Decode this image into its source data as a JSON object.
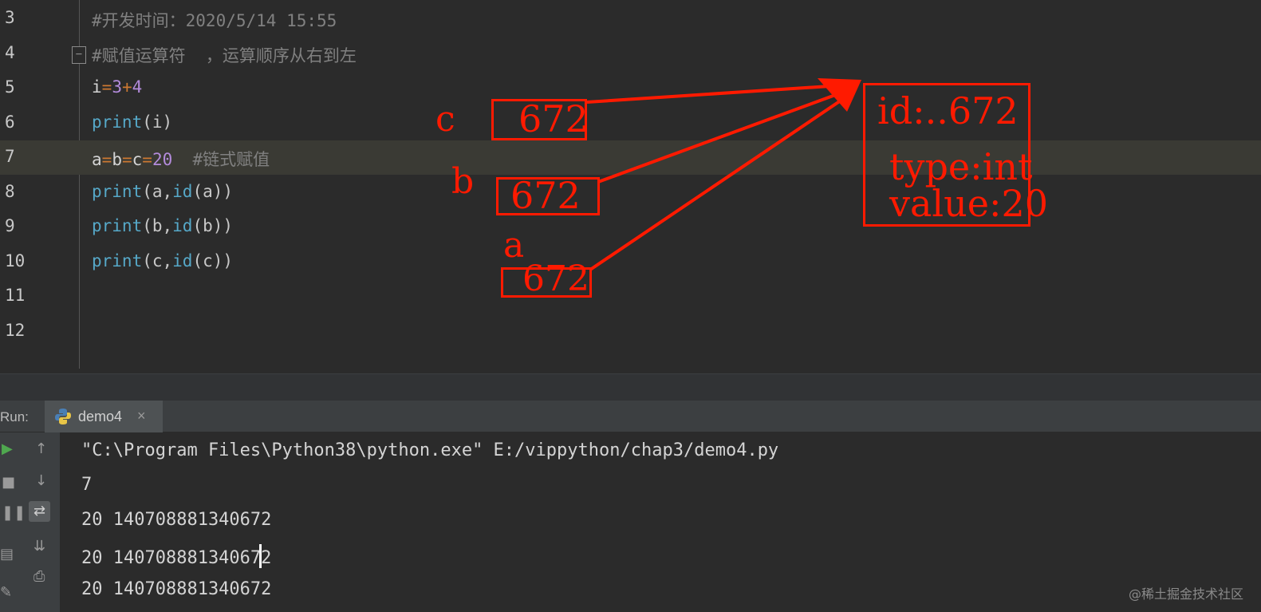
{
  "editor": {
    "lines": [
      {
        "num": "3",
        "segments": [
          {
            "t": "#开发时间：2020/5/14 15:55",
            "c": "comment"
          }
        ]
      },
      {
        "num": "4",
        "fold": "−",
        "segments": [
          {
            "t": "#赋值运算符  ，运算顺序从右到左",
            "c": "comment"
          }
        ]
      },
      {
        "num": "5",
        "segments": [
          {
            "t": "i",
            "c": "var"
          },
          {
            "t": "=",
            "c": "op"
          },
          {
            "t": "3",
            "c": "num"
          },
          {
            "t": "+",
            "c": "op"
          },
          {
            "t": "4",
            "c": "num"
          }
        ]
      },
      {
        "num": "6",
        "segments": [
          {
            "t": "print",
            "c": "fn"
          },
          {
            "t": "(i)",
            "c": "paren"
          }
        ]
      },
      {
        "num": "7",
        "current": true,
        "segments": [
          {
            "t": "a",
            "c": "var"
          },
          {
            "t": "=",
            "c": "op"
          },
          {
            "t": "b",
            "c": "var"
          },
          {
            "t": "=",
            "c": "op"
          },
          {
            "t": "c",
            "c": "var"
          },
          {
            "t": "=",
            "c": "op"
          },
          {
            "t": "20",
            "c": "num"
          },
          {
            "t": "  #链式赋值",
            "c": "comment"
          }
        ]
      },
      {
        "num": "8",
        "segments": [
          {
            "t": "print",
            "c": "fn"
          },
          {
            "t": "(a,",
            "c": "paren"
          },
          {
            "t": "id",
            "c": "fn"
          },
          {
            "t": "(a))",
            "c": "paren"
          }
        ]
      },
      {
        "num": "9",
        "segments": [
          {
            "t": "print",
            "c": "fn"
          },
          {
            "t": "(b,",
            "c": "paren"
          },
          {
            "t": "id",
            "c": "fn"
          },
          {
            "t": "(b))",
            "c": "paren"
          }
        ]
      },
      {
        "num": "10",
        "segments": [
          {
            "t": "print",
            "c": "fn"
          },
          {
            "t": "(c,",
            "c": "paren"
          },
          {
            "t": "id",
            "c": "fn"
          },
          {
            "t": "(c))",
            "c": "paren"
          }
        ]
      },
      {
        "num": "11",
        "segments": []
      },
      {
        "num": "12",
        "segments": []
      }
    ]
  },
  "annotation": {
    "color": "#ff1a00",
    "var_c": "c",
    "var_b": "b",
    "var_a": "a",
    "ref_c": "672",
    "ref_b": "672",
    "ref_a": "672",
    "obj_id": "id:..672",
    "obj_type": "type:int",
    "obj_value": "value:20"
  },
  "run_panel": {
    "label": "Run:",
    "tab_name": "demo4",
    "tab_close": "×",
    "console_lines": [
      "\"C:\\Program Files\\Python38\\python.exe\" E:/vippython/chap3/demo4.py",
      "7",
      "20 140708881340672",
      "20 14070888134067|2",
      "20 140708881340672"
    ],
    "toolbar_icons": [
      "play-icon",
      "stop-icon",
      "pause-icon",
      "layout-icon",
      "pin-icon",
      "up-arrow-icon",
      "down-arrow-icon",
      "soft-wrap-icon",
      "scroll-to-end-icon",
      "print-icon"
    ]
  },
  "watermark": "@稀土掘金技术社区"
}
